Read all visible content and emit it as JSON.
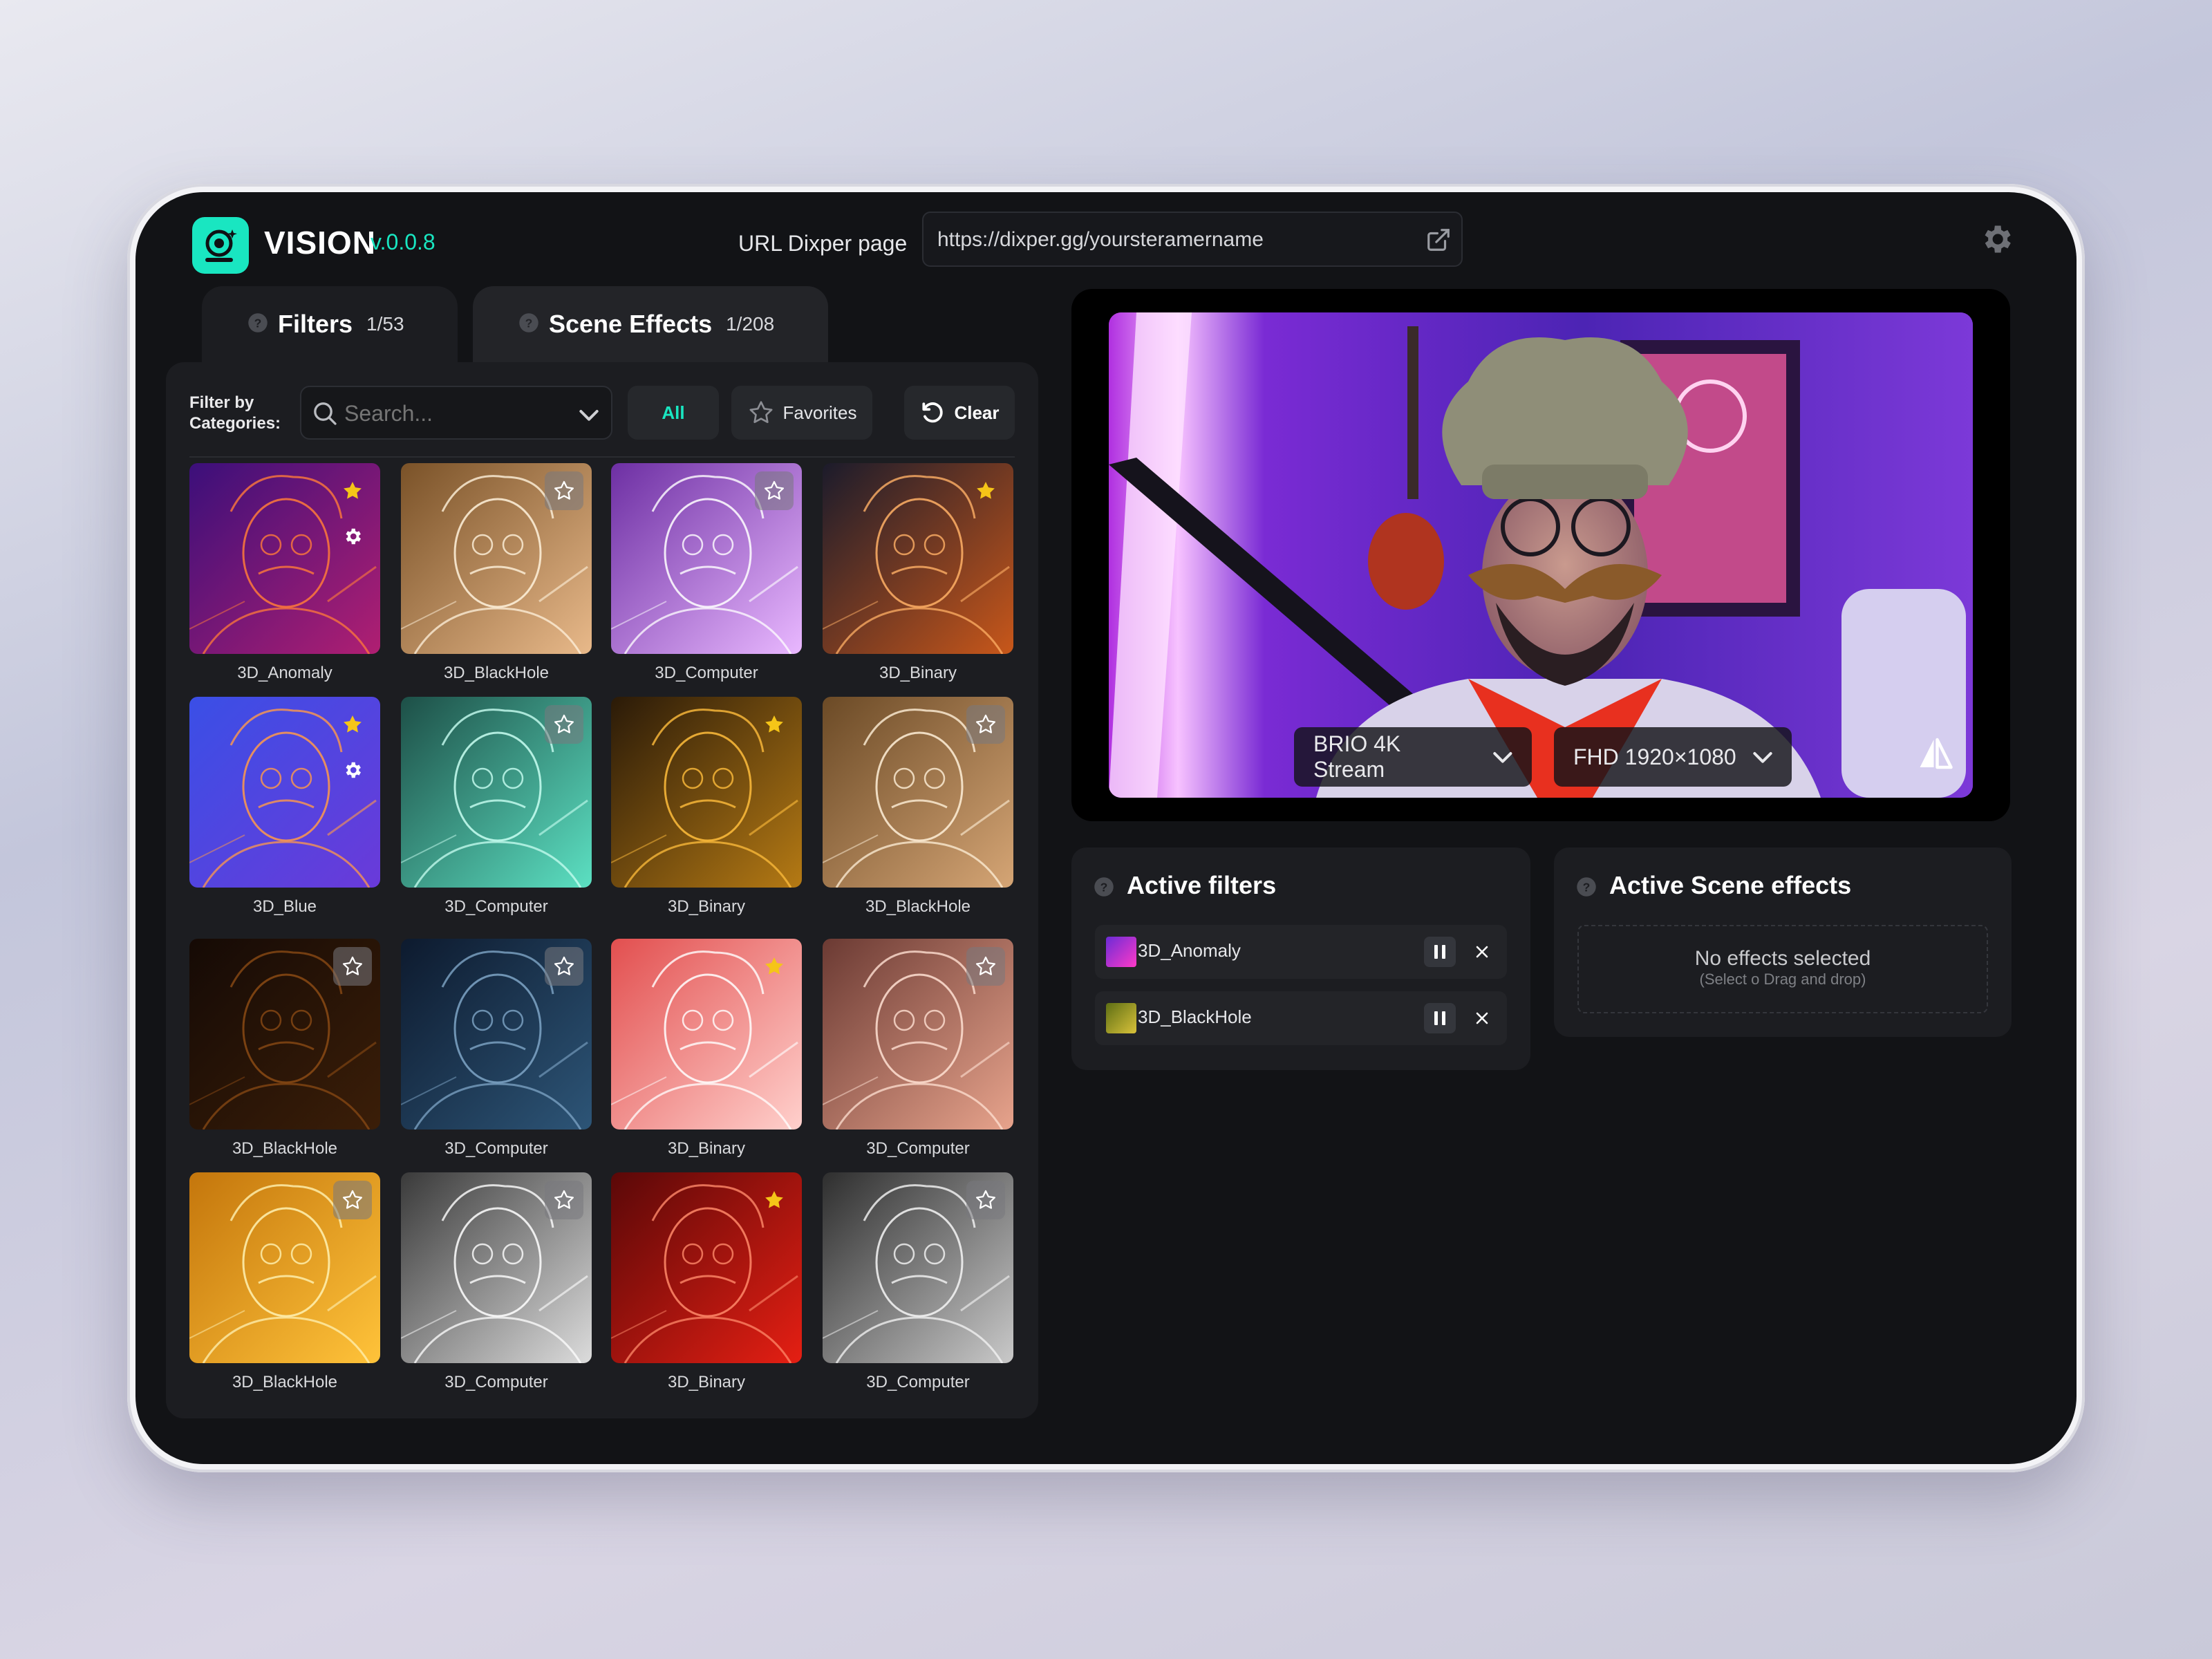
{
  "app": {
    "name": "VISION",
    "version": "v.0.0.8"
  },
  "url": {
    "label": "URL Dixper page",
    "value": "https://dixper.gg/yoursteramername"
  },
  "tabs": [
    {
      "name": "Filters",
      "count": "1/53"
    },
    {
      "name": "Scene Effects",
      "count": "1/208"
    }
  ],
  "filter_bar": {
    "label_line1": "Filter by",
    "label_line2": "Categories:",
    "search_placeholder": "Search...",
    "all_label": "All",
    "favorites_label": "Favorites",
    "clear_label": "Clear"
  },
  "tiles": [
    {
      "label": "3D_Anomaly",
      "favorite": true,
      "settings": true,
      "colors": [
        "#3b0f7a",
        "#b01f72"
      ],
      "line": "#ff7a3a"
    },
    {
      "label": "3D_BlackHole",
      "favorite": false,
      "settings": false,
      "colors": [
        "#7a5228",
        "#e8b98a"
      ],
      "line": "#fff2dc"
    },
    {
      "label": "3D_Computer",
      "favorite": false,
      "settings": false,
      "colors": [
        "#6d2fa3",
        "#e9b8ff"
      ],
      "line": "#ffffff"
    },
    {
      "label": "3D_Binary",
      "favorite": true,
      "settings": false,
      "colors": [
        "#1b1b2b",
        "#c8571a"
      ],
      "line": "#ffb066"
    },
    {
      "label": "3D_Blue",
      "favorite": true,
      "settings": true,
      "colors": [
        "#3a4fe6",
        "#6a3ad9"
      ],
      "line": "#ff9a4a"
    },
    {
      "label": "3D_Computer",
      "favorite": false,
      "settings": false,
      "colors": [
        "#1d4f47",
        "#5ce0c2"
      ],
      "line": "#c9fff2"
    },
    {
      "label": "3D_Binary",
      "favorite": true,
      "settings": false,
      "colors": [
        "#2a1a08",
        "#b57a14"
      ],
      "line": "#ffbd3c"
    },
    {
      "label": "3D_BlackHole",
      "favorite": false,
      "settings": false,
      "colors": [
        "#6b4a26",
        "#d5a575"
      ],
      "line": "#fff0d8"
    },
    {
      "label": "3D_BlackHole",
      "favorite": false,
      "settings": false,
      "colors": [
        "#150a05",
        "#3b1e08"
      ],
      "line": "#8a4a14"
    },
    {
      "label": "3D_Computer",
      "favorite": false,
      "settings": false,
      "colors": [
        "#0d1a2e",
        "#2d5577"
      ],
      "line": "#7fa6c7"
    },
    {
      "label": "3D_Binary",
      "favorite": true,
      "settings": false,
      "colors": [
        "#e24f4f",
        "#ffd0cc"
      ],
      "line": "#ffffff"
    },
    {
      "label": "3D_Computer",
      "favorite": false,
      "settings": false,
      "colors": [
        "#6b3a33",
        "#e7a38c"
      ],
      "line": "#ffe0d2"
    },
    {
      "label": "3D_BlackHole",
      "favorite": false,
      "settings": false,
      "colors": [
        "#c4760c",
        "#ffc33a"
      ],
      "line": "#fff2b3"
    },
    {
      "label": "3D_Computer",
      "favorite": false,
      "settings": false,
      "colors": [
        "#3a3a3a",
        "#dcdcdc"
      ],
      "line": "#ffffff"
    },
    {
      "label": "3D_Binary",
      "favorite": true,
      "settings": false,
      "colors": [
        "#5a0808",
        "#e51f13"
      ],
      "line": "#ff8a6a"
    },
    {
      "label": "3D_Computer",
      "favorite": false,
      "settings": false,
      "colors": [
        "#2e2e2e",
        "#c9c9c9"
      ],
      "line": "#f6f6f6"
    }
  ],
  "preview": {
    "camera": "BRIO 4K Stream",
    "resolution": "FHD 1920×1080"
  },
  "active_filters": {
    "title": "Active filters",
    "items": [
      {
        "name": "3D_Anomaly",
        "thumb_colors": [
          "#6b2bd6",
          "#ff3ac8"
        ]
      },
      {
        "name": "3D_BlackHole",
        "thumb_colors": [
          "#5d6e14",
          "#d9c23a"
        ]
      }
    ]
  },
  "active_scene_effects": {
    "title": "Active Scene effects",
    "empty_title": "No effects selected",
    "empty_hint": "(Select o Drag and drop)"
  },
  "colors": {
    "accent": "#19e6c1",
    "star": "#f5c518"
  },
  "icons": [
    "camera-logo-icon",
    "external-link-icon",
    "gear-icon",
    "help-icon",
    "search-icon",
    "chevron-down-icon",
    "star-icon",
    "undo-icon",
    "mirror-icon",
    "pause-icon",
    "close-icon"
  ]
}
